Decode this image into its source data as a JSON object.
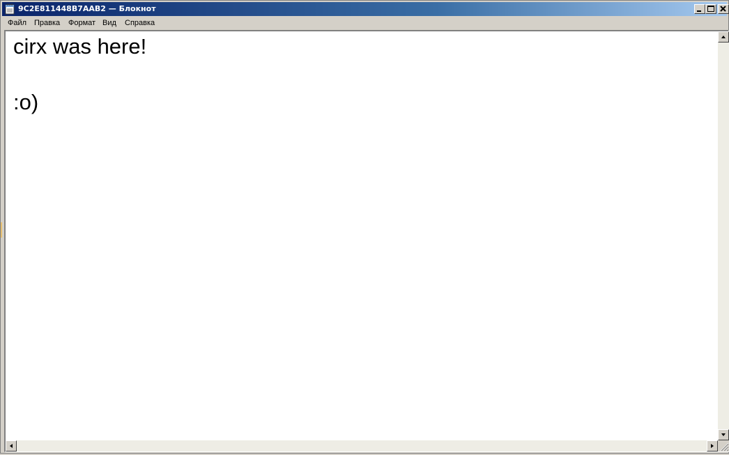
{
  "window": {
    "title": "9C2E811448B7AAB2 — Блокнот",
    "title_icon": "notepad-icon",
    "accent_color": "#0a246a"
  },
  "caption_buttons": {
    "minimize": "minimize-icon",
    "maximize": "maximize-icon",
    "close": "close-icon"
  },
  "menu": {
    "items": [
      {
        "label": "Файл"
      },
      {
        "label": "Правка"
      },
      {
        "label": "Формат"
      },
      {
        "label": "Вид"
      },
      {
        "label": "Справка"
      }
    ]
  },
  "document": {
    "lines": [
      "cirx was here!",
      "",
      ":o)"
    ]
  },
  "scrollbars": {
    "vertical_up": "arrow-up-icon",
    "vertical_down": "arrow-down-icon",
    "horizontal_left": "arrow-left-icon",
    "horizontal_right": "arrow-right-icon",
    "grip": "resize-grip-icon"
  }
}
